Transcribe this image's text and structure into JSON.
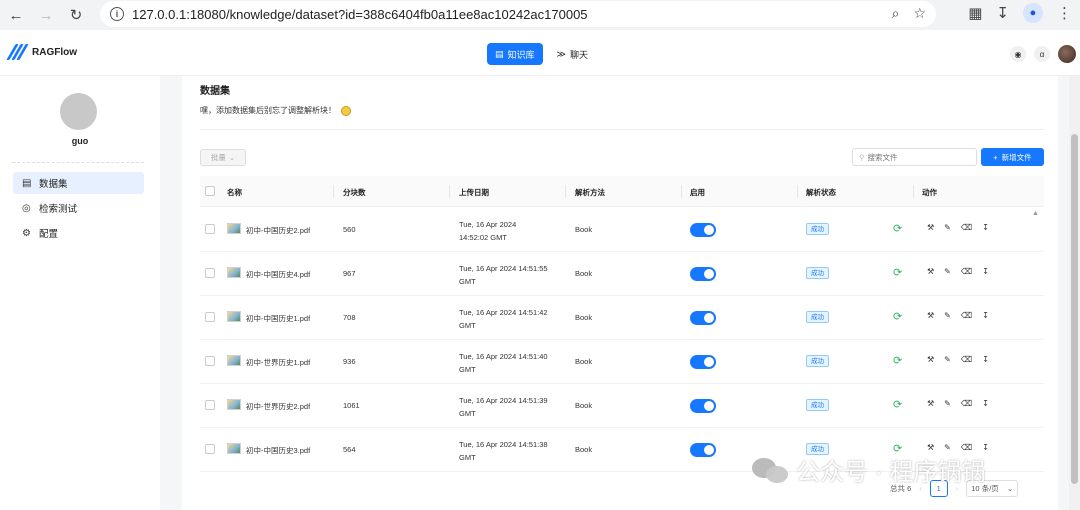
{
  "browser": {
    "url": "127.0.0.1:18080/knowledge/dataset?id=388c6404fb0a11ee8ac10242ac170005"
  },
  "header": {
    "logo_text": "RAGFlow",
    "tabs": [
      {
        "label": "知识库",
        "active": true
      },
      {
        "label": "聊天",
        "active": false
      }
    ]
  },
  "sidebar": {
    "username": "guo",
    "items": [
      {
        "label": "数据集",
        "active": true,
        "icon": "file-icon"
      },
      {
        "label": "检索测试",
        "active": false,
        "icon": "target-icon"
      },
      {
        "label": "配置",
        "active": false,
        "icon": "gear-icon"
      }
    ]
  },
  "main": {
    "title": "数据集",
    "subtitle": "嘿，添加数据集后别忘了调整解析块！",
    "batch_label": "批量",
    "search_placeholder": "搜索文件",
    "new_file_label": "新增文件",
    "columns": [
      "名称",
      "分块数",
      "上传日期",
      "解析方法",
      "启用",
      "解析状态",
      "动作"
    ],
    "rows": [
      {
        "name": "初中-中国历史2.pdf",
        "chunks": "560",
        "date_line1": "Tue, 16 Apr 2024",
        "date_line2": "14:52:02 GMT",
        "method": "Book",
        "status": "成功"
      },
      {
        "name": "初中-中国历史4.pdf",
        "chunks": "967",
        "date_line1": "Tue, 16 Apr 2024 14:51:55",
        "date_line2": "GMT",
        "method": "Book",
        "status": "成功"
      },
      {
        "name": "初中-中国历史1.pdf",
        "chunks": "708",
        "date_line1": "Tue, 16 Apr 2024 14:51:42",
        "date_line2": "GMT",
        "method": "Book",
        "status": "成功"
      },
      {
        "name": "初中-世界历史1.pdf",
        "chunks": "936",
        "date_line1": "Tue, 16 Apr 2024 14:51:40",
        "date_line2": "GMT",
        "method": "Book",
        "status": "成功"
      },
      {
        "name": "初中-世界历史2.pdf",
        "chunks": "1061",
        "date_line1": "Tue, 16 Apr 2024 14:51:39",
        "date_line2": "GMT",
        "method": "Book",
        "status": "成功"
      },
      {
        "name": "初中-中国历史3.pdf",
        "chunks": "564",
        "date_line1": "Tue, 16 Apr 2024 14:51:38",
        "date_line2": "GMT",
        "method": "Book",
        "status": "成功"
      }
    ],
    "pagination": {
      "total_label": "总共 6",
      "current_page": "1",
      "per_page": "10 条/页"
    }
  },
  "watermark": "公众号 · 程序锅锅",
  "colors": {
    "accent": "#1677ff",
    "success": "#2db55d"
  }
}
